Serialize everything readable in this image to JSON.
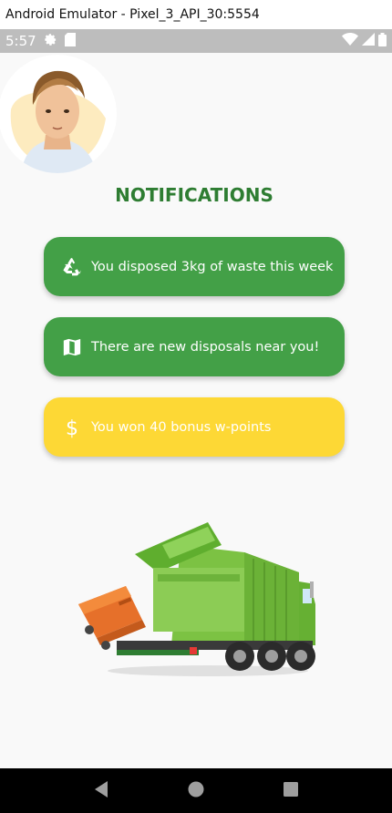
{
  "window": {
    "title": "Android Emulator - Pixel_3_API_30:5554"
  },
  "status_bar": {
    "time": "5:57"
  },
  "header": {
    "title": "NOTIFICATIONS"
  },
  "notifications": [
    {
      "icon": "recycle-icon",
      "text": "You disposed 3kg of waste this week",
      "color": "#43a047"
    },
    {
      "icon": "map-icon",
      "text": "There are new disposals near you!",
      "color": "#43a047"
    },
    {
      "icon": "dollar-icon",
      "text": "You won 40 bonus w-points",
      "color": "#fdd835"
    }
  ],
  "colors": {
    "title_green": "#2e7d32",
    "card_green": "#43a047",
    "card_yellow": "#fdd835",
    "status_gray": "#bdbdbd"
  }
}
